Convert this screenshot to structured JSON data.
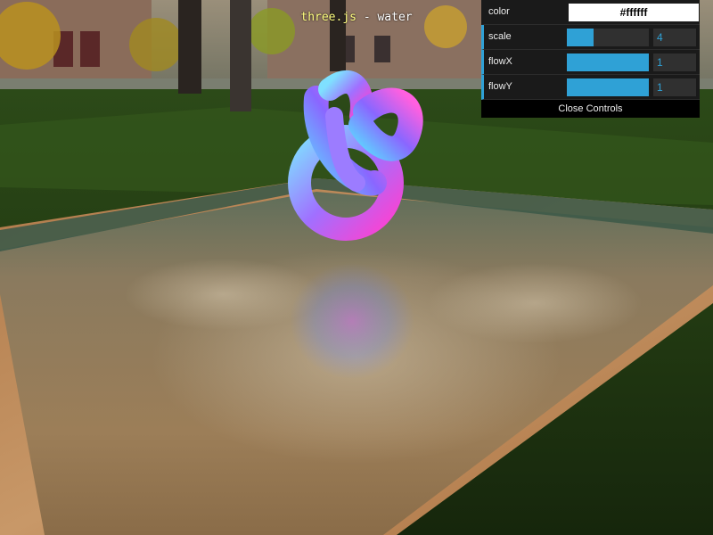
{
  "header": {
    "title_link": "three.js",
    "title_rest": " - water"
  },
  "gui": {
    "controls": [
      {
        "kind": "color",
        "label": "color",
        "value": "#ffffff"
      },
      {
        "kind": "number",
        "label": "scale",
        "value": "4",
        "fraction": 0.33
      },
      {
        "kind": "number",
        "label": "flowX",
        "value": "1",
        "fraction": 1.0
      },
      {
        "kind": "number",
        "label": "flowY",
        "value": "1",
        "fraction": 1.0
      }
    ],
    "close_label": "Close Controls"
  },
  "colors": {
    "accent": "#2fa1d6",
    "panel_bg": "#1a1a1a",
    "link": "#ffff80"
  },
  "scene": {
    "icon_names": [
      "torus-knot",
      "water-plane",
      "park-background"
    ]
  }
}
